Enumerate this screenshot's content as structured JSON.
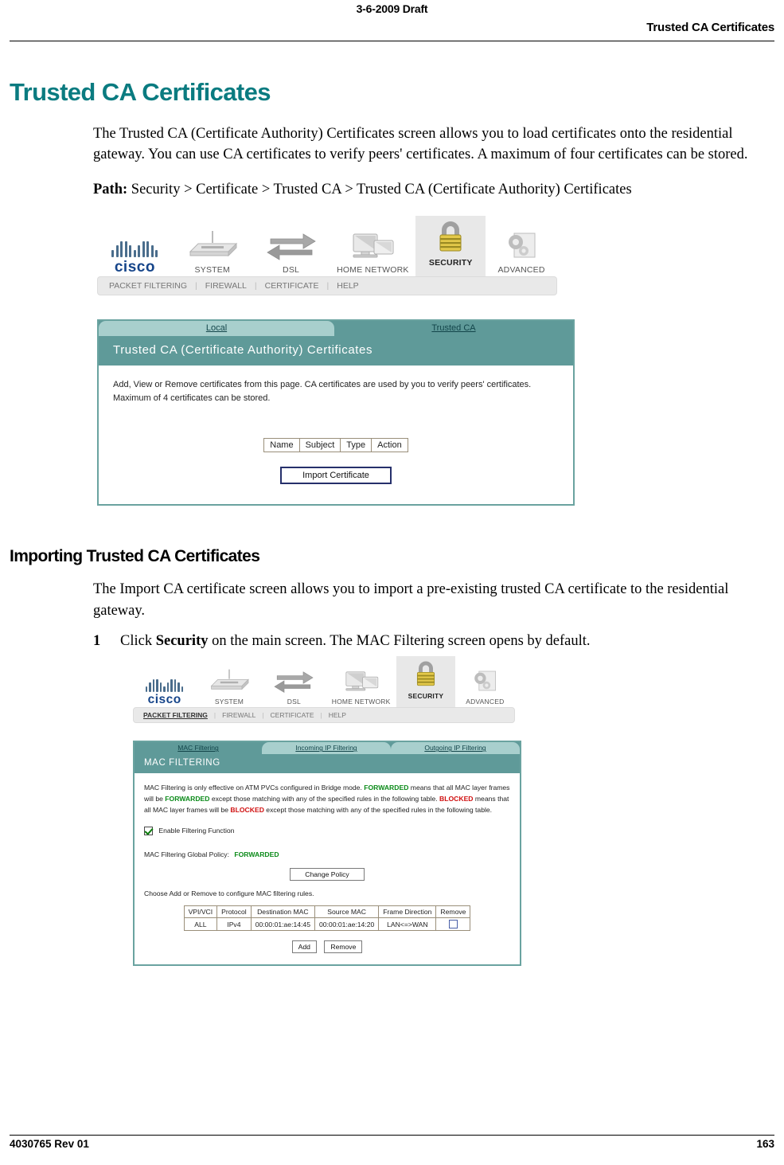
{
  "header": {
    "draft_stamp": "3-6-2009 Draft",
    "running_title": "Trusted CA Certificates"
  },
  "footer": {
    "doc_number": "4030765 Rev 01",
    "page_number": "163"
  },
  "chapter": {
    "title": "Trusted CA Certificates",
    "intro": "The Trusted CA (Certificate Authority) Certificates screen allows you to load certificates onto the residential gateway. You can use CA certificates to verify peers' certificates. A maximum of four certificates can be stored.",
    "path_label": "Path",
    "path_value": "Security > Certificate > Trusted CA > Trusted CA (Certificate Authority) Certificates"
  },
  "section": {
    "title": "Importing Trusted CA Certificates",
    "intro": "The Import CA certificate screen allows you to import a pre-existing trusted CA certificate to the residential gateway.",
    "steps": [
      {
        "number": "1",
        "text_before": "Click ",
        "bold": "Security",
        "text_after": " on the main screen. The MAC Filtering screen opens by default."
      }
    ]
  },
  "screenshot_certificates": {
    "nav": {
      "brand": "cisco",
      "items": [
        {
          "label": "SYSTEM",
          "icon": "router-icon",
          "active": false
        },
        {
          "label": "DSL",
          "icon": "arrows-exchange-icon",
          "active": false
        },
        {
          "label": "HOME NETWORK",
          "icon": "monitors-icon",
          "active": false
        },
        {
          "label": "SECURITY",
          "icon": "padlock-icon",
          "active": true
        },
        {
          "label": "ADVANCED",
          "icon": "gears-document-icon",
          "active": false
        }
      ],
      "subitems": [
        {
          "label": "PACKET FILTERING",
          "active": false
        },
        {
          "label": "FIREWALL",
          "active": false
        },
        {
          "label": "CERTIFICATE",
          "active": false
        },
        {
          "label": "HELP",
          "active": false
        }
      ]
    },
    "tabs": [
      {
        "label": "Local",
        "active": false
      },
      {
        "label": "Trusted CA",
        "active": true
      }
    ],
    "panel_title": "Trusted CA (Certificate Authority) Certificates",
    "description_line1": "Add, View or Remove certificates from this page. CA certificates are used by you to verify peers' certificates.",
    "description_line2": "Maximum of 4 certificates can be stored.",
    "table": {
      "headers": [
        "Name",
        "Subject",
        "Type",
        "Action"
      ],
      "rows": []
    },
    "import_button": "Import Certificate"
  },
  "screenshot_mac_filtering": {
    "nav": {
      "brand": "cisco",
      "items": [
        {
          "label": "SYSTEM",
          "icon": "router-icon",
          "active": false
        },
        {
          "label": "DSL",
          "icon": "arrows-exchange-icon",
          "active": false
        },
        {
          "label": "HOME NETWORK",
          "icon": "monitors-icon",
          "active": false
        },
        {
          "label": "SECURITY",
          "icon": "padlock-icon",
          "active": true
        },
        {
          "label": "ADVANCED",
          "icon": "gears-document-icon",
          "active": false
        }
      ],
      "subitems": [
        {
          "label": "PACKET FILTERING",
          "active": true
        },
        {
          "label": "FIREWALL",
          "active": false
        },
        {
          "label": "CERTIFICATE",
          "active": false
        },
        {
          "label": "HELP",
          "active": false
        }
      ]
    },
    "tabs": [
      {
        "label": "MAC Filtering",
        "active": true
      },
      {
        "label": "Incoming IP Filtering",
        "active": false
      },
      {
        "label": "Outgoing IP Filtering",
        "active": false
      }
    ],
    "panel_title": "MAC FILTERING",
    "desc_part1": "MAC Filtering is only effective on ATM PVCs configured in Bridge mode. ",
    "desc_forwarded1": "FORWARDED",
    "desc_part2": " means that all MAC layer frames will be ",
    "desc_forwarded2": "FORWARDED",
    "desc_part3": " except those matching with any of the specified rules in the following table. ",
    "desc_blocked1": "BLOCKED",
    "desc_part4": " means that all MAC layer frames will be ",
    "desc_blocked2": "BLOCKED",
    "desc_part5": " except those matching with any of the specified rules in the following table.",
    "enable_checkbox_label": "Enable Filtering Function",
    "enable_checkbox_checked": true,
    "global_policy_label": "MAC Filtering Global Policy:",
    "global_policy_value": "FORWARDED",
    "change_policy_button": "Change Policy",
    "rules_hint": "Choose Add or Remove to configure MAC filtering rules.",
    "table": {
      "headers": [
        "VPI/VCI",
        "Protocol",
        "Destination MAC",
        "Source MAC",
        "Frame Direction",
        "Remove"
      ],
      "rows": [
        {
          "vpi_vci": "ALL",
          "protocol": "IPv4",
          "destination_mac": "00:00:01:ae:14:45",
          "source_mac": "00:00:01:ae:14:20",
          "frame_direction": "LAN<=>WAN",
          "remove_checked": false
        }
      ]
    },
    "add_button": "Add",
    "remove_button": "Remove"
  },
  "colors": {
    "heading_teal": "#0a7b80",
    "panel_teal": "#5f9a99",
    "panel_teal_light": "#a8cfcd",
    "status_green": "#0a8a18",
    "status_red": "#d01010"
  }
}
